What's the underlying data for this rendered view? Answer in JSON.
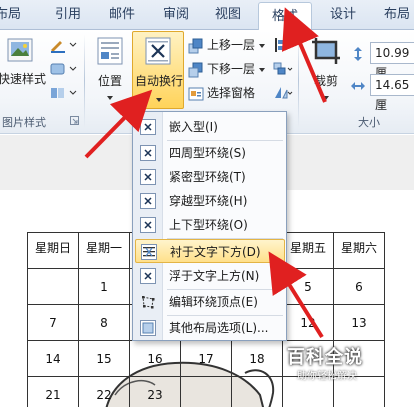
{
  "tabs": [
    {
      "label": "布局",
      "active": false
    },
    {
      "label": "引用",
      "active": false
    },
    {
      "label": "邮件",
      "active": false
    },
    {
      "label": "审阅",
      "active": false
    },
    {
      "label": "视图",
      "active": false
    },
    {
      "label": "格式",
      "active": true
    },
    {
      "label": "设计",
      "active": false
    },
    {
      "label": "布局",
      "active": false
    }
  ],
  "ribbon": {
    "quick_styles_label": "快速样式",
    "picture_styles_group": "图片样式",
    "position_label": "位置",
    "auto_wrap_label": "自动换行",
    "bring_forward_label": "上移一层",
    "send_backward_label": "下移一层",
    "selection_pane_label": "选择窗格",
    "crop_label": "裁剪",
    "height_value": "10.99 厘",
    "width_value": "14.65 厘",
    "size_group": "大小"
  },
  "menu": {
    "items": [
      {
        "label": "嵌入型(I)",
        "icon": "wrap-inline-icon"
      },
      {
        "label": "四周型环绕(S)",
        "icon": "wrap-square-icon"
      },
      {
        "label": "紧密型环绕(T)",
        "icon": "wrap-tight-icon"
      },
      {
        "label": "穿越型环绕(H)",
        "icon": "wrap-through-icon"
      },
      {
        "label": "上下型环绕(O)",
        "icon": "wrap-top-bottom-icon"
      },
      {
        "label": "衬于文字下方(D)",
        "icon": "wrap-behind-text-icon",
        "highlighted": true
      },
      {
        "label": "浮于文字上方(N)",
        "icon": "wrap-in-front-icon"
      },
      {
        "label": "编辑环绕顶点(E)",
        "icon": "edit-wrap-points-icon"
      },
      {
        "label": "其他布局选项(L)...",
        "icon": "more-layout-options-icon"
      }
    ]
  },
  "calendar": {
    "headers": [
      "星期日",
      "星期一",
      "",
      "",
      "",
      "星期五",
      "星期六"
    ],
    "rows": [
      [
        "",
        "1",
        "",
        "",
        "",
        "5",
        "6"
      ],
      [
        "7",
        "8",
        "",
        "",
        "",
        "12",
        "13"
      ],
      [
        "14",
        "15",
        "16",
        "17",
        "18",
        "",
        ""
      ],
      [
        "21",
        "22",
        "23",
        "",
        "",
        "",
        ""
      ]
    ]
  },
  "watermark": {
    "logo": "百科全说",
    "sub": "助你轻松解决"
  },
  "colors": {
    "arrow": "#e02020",
    "menu_highlight": "#ffe08a",
    "ribbon_button_highlight": "#ffd35a"
  }
}
